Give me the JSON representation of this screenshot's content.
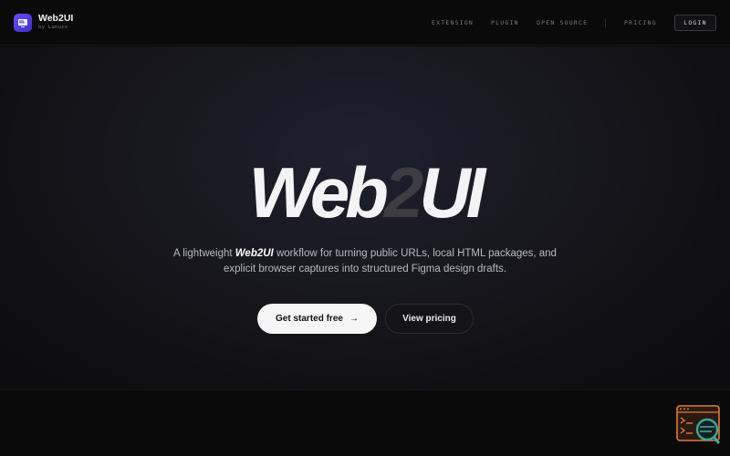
{
  "brand": {
    "name": "Web2UI",
    "subtitle": "by Lanuco",
    "logo_label": "Web2UI"
  },
  "nav": {
    "links": [
      "EXTENSION",
      "PLUGIN",
      "OPEN SOURCE",
      "PRICING"
    ],
    "login": "LOGIN"
  },
  "hero": {
    "title_part1": "Web",
    "title_accent": "2",
    "title_part2": "UI",
    "description_pre": "A lightweight ",
    "description_brand": "Web2UI",
    "description_post": " workflow for turning public URLs, local HTML packages, and explicit browser captures into structured Figma design drafts.",
    "primary_cta": "Get started free",
    "secondary_cta": "View pricing"
  },
  "icons": {
    "logo": "app-logo-icon",
    "cta_arrow": "arrow-right-icon",
    "widget": "terminal-search-icon"
  },
  "colors": {
    "background": "#0b0b0d",
    "logo_accent": "#6a4df5",
    "title": "#f4f4f6",
    "title_accent": "#3c3c42",
    "widget_outline": "#e07a3a",
    "widget_lens": "#3aa89a"
  }
}
